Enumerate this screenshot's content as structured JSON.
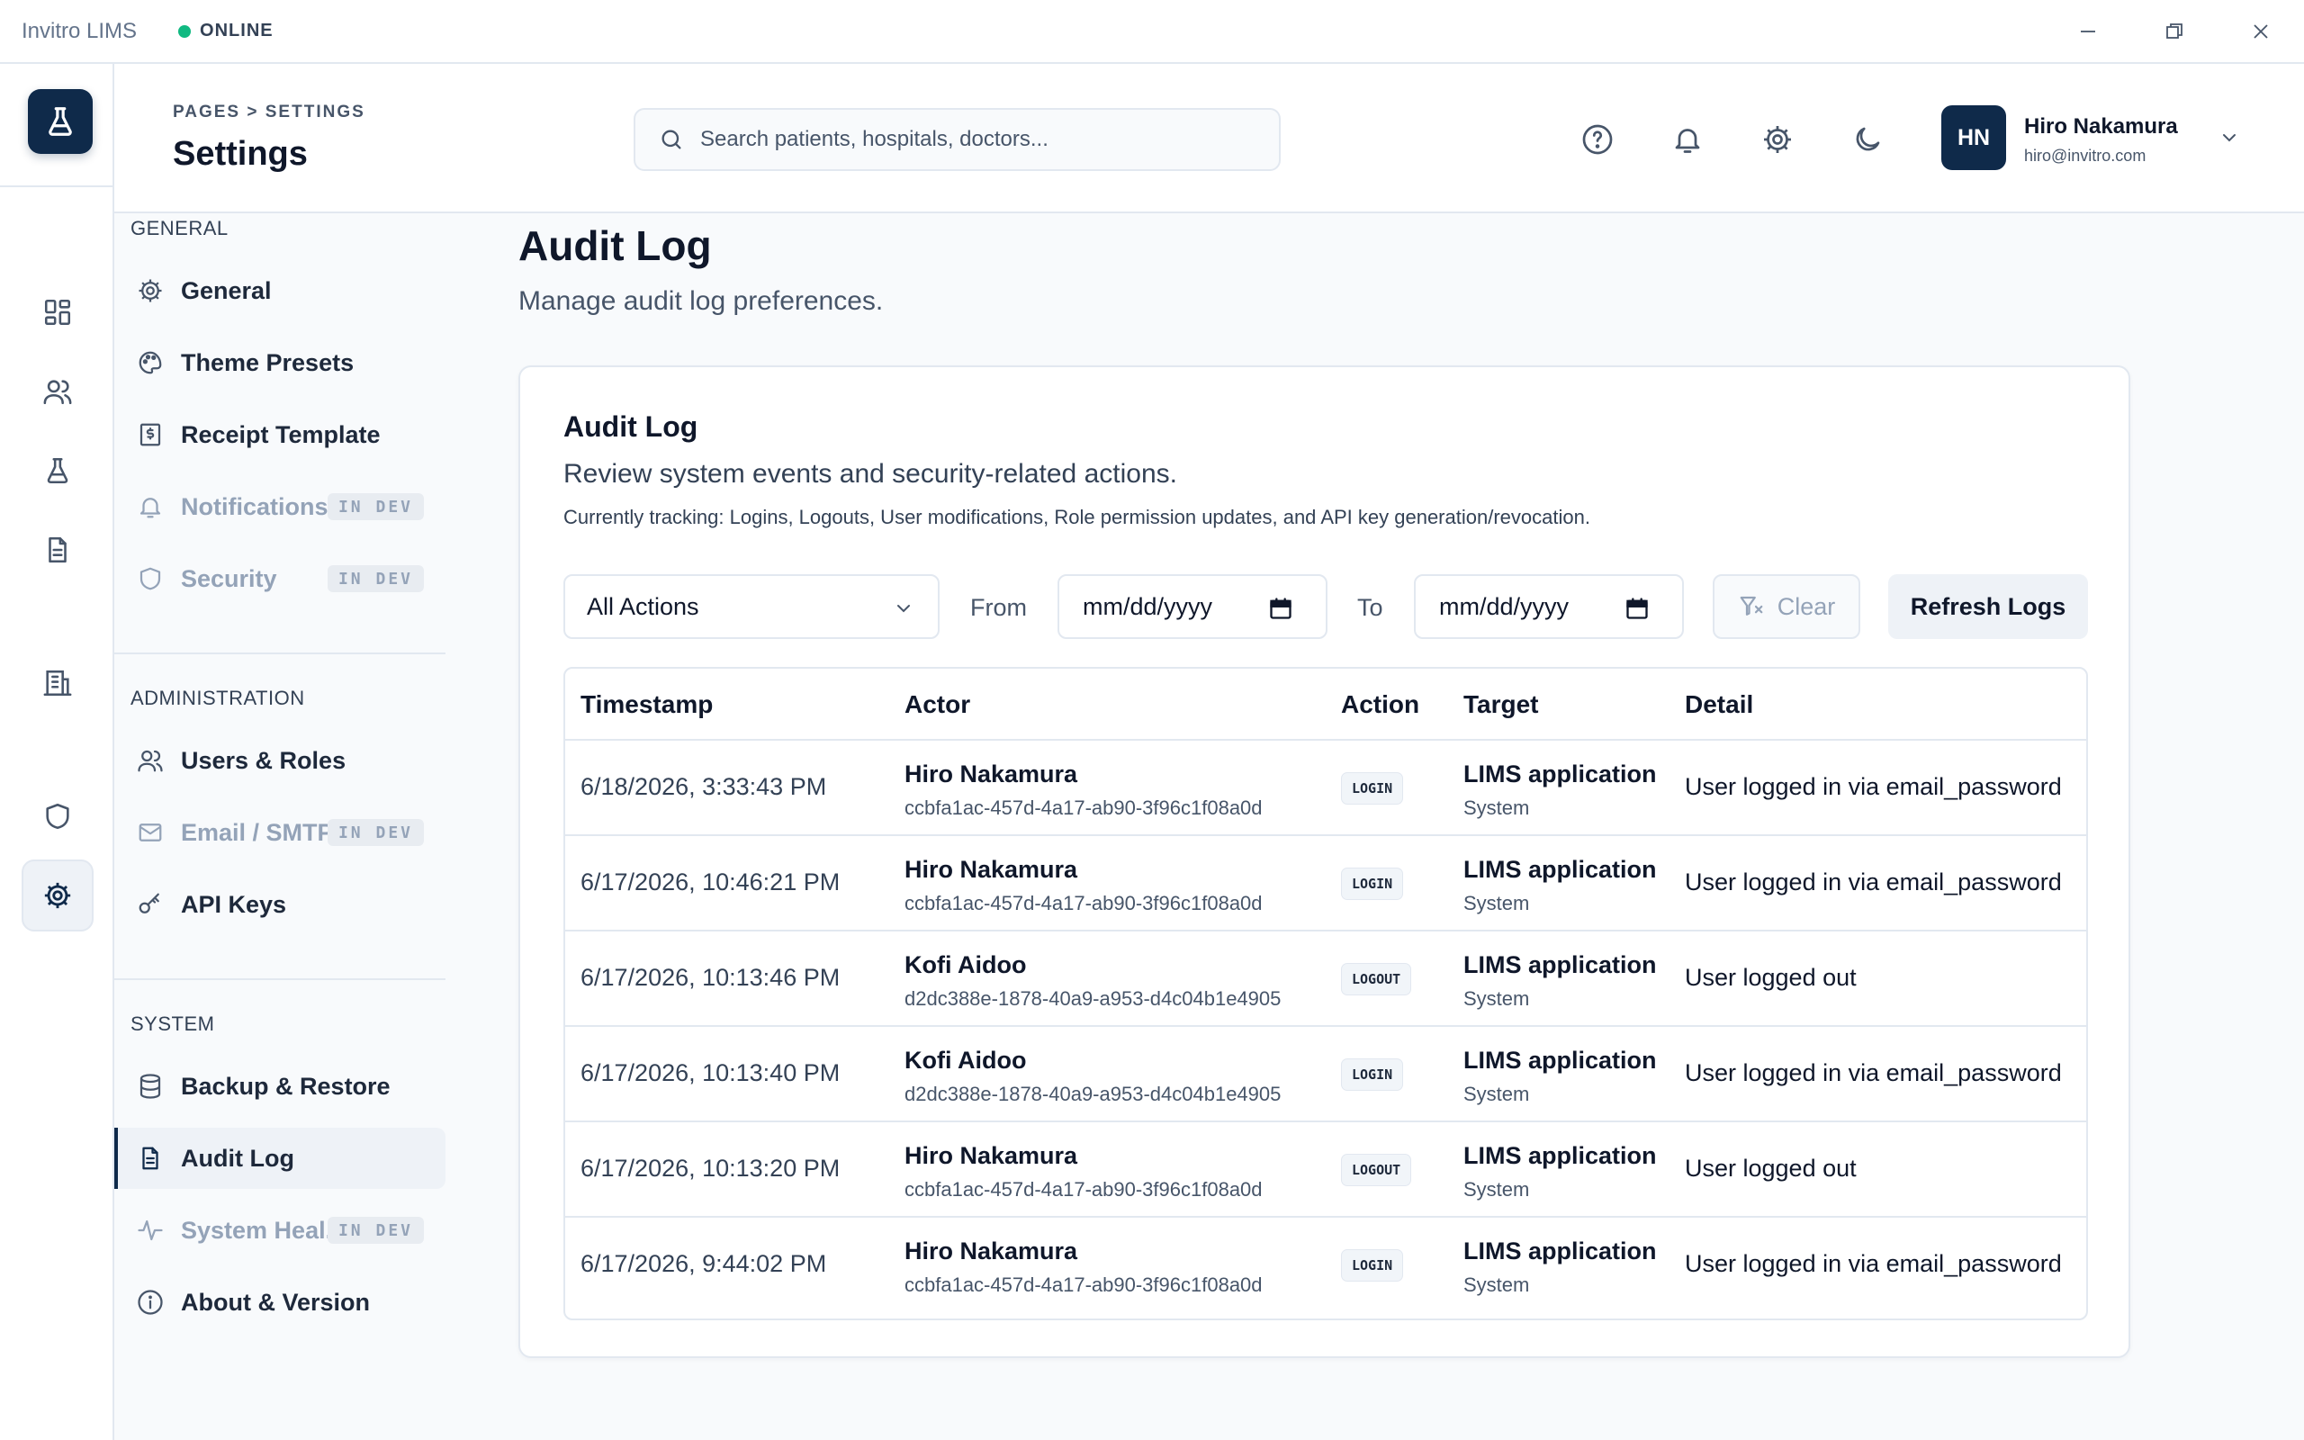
{
  "window": {
    "app_name": "Invitro LIMS",
    "status": "ONLINE"
  },
  "header": {
    "breadcrumb": "PAGES > SETTINGS",
    "title": "Settings",
    "search_placeholder": "Search patients, hospitals, doctors...",
    "user": {
      "initials": "HN",
      "name": "Hiro Nakamura",
      "email": "hiro@invitro.com"
    }
  },
  "settings_nav": {
    "sections": [
      {
        "label": "GENERAL",
        "items": [
          {
            "label": "General",
            "icon": "gear-icon"
          },
          {
            "label": "Theme Presets",
            "icon": "palette-icon"
          },
          {
            "label": "Receipt Template",
            "icon": "receipt-icon"
          },
          {
            "label": "Notifications",
            "icon": "bell-icon",
            "badge": "IN DEV"
          },
          {
            "label": "Security",
            "icon": "shield-icon",
            "badge": "IN DEV"
          }
        ]
      },
      {
        "label": "ADMINISTRATION",
        "items": [
          {
            "label": "Users & Roles",
            "icon": "users-icon"
          },
          {
            "label": "Email / SMTP",
            "icon": "mail-icon",
            "badge": "IN DEV"
          },
          {
            "label": "API Keys",
            "icon": "key-icon"
          }
        ]
      },
      {
        "label": "SYSTEM",
        "items": [
          {
            "label": "Backup & Restore",
            "icon": "database-icon"
          },
          {
            "label": "Audit Log",
            "icon": "document-icon",
            "active": true
          },
          {
            "label": "System Heal...",
            "icon": "activity-icon",
            "badge": "IN DEV"
          },
          {
            "label": "About & Version",
            "icon": "info-icon"
          }
        ]
      }
    ]
  },
  "main": {
    "title": "Audit Log",
    "subtitle": "Manage audit log preferences.",
    "card": {
      "title": "Audit Log",
      "subtitle": "Review system events and security-related actions.",
      "note": "Currently tracking: Logins, Logouts, User modifications, Role permission updates, and API key generation/revocation.",
      "filters": {
        "action_select": "All Actions",
        "from_label": "From",
        "from_value": "mm/dd/yyyy",
        "to_label": "To",
        "to_value": "mm/dd/yyyy",
        "clear_label": "Clear",
        "refresh_label": "Refresh Logs"
      },
      "table": {
        "columns": [
          "Timestamp",
          "Actor",
          "Action",
          "Target",
          "Detail"
        ],
        "rows": [
          {
            "timestamp": "6/18/2026, 3:33:43 PM",
            "actor": "Hiro Nakamura",
            "actor_id": "ccbfa1ac-457d-4a17-ab90-3f96c1f08a0d",
            "action": "LOGIN",
            "target": "LIMS application",
            "target_type": "System",
            "detail": "User logged in via email_password"
          },
          {
            "timestamp": "6/17/2026, 10:46:21 PM",
            "actor": "Hiro Nakamura",
            "actor_id": "ccbfa1ac-457d-4a17-ab90-3f96c1f08a0d",
            "action": "LOGIN",
            "target": "LIMS application",
            "target_type": "System",
            "detail": "User logged in via email_password"
          },
          {
            "timestamp": "6/17/2026, 10:13:46 PM",
            "actor": "Kofi Aidoo",
            "actor_id": "d2dc388e-1878-40a9-a953-d4c04b1e4905",
            "action": "LOGOUT",
            "target": "LIMS application",
            "target_type": "System",
            "detail": "User logged out"
          },
          {
            "timestamp": "6/17/2026, 10:13:40 PM",
            "actor": "Kofi Aidoo",
            "actor_id": "d2dc388e-1878-40a9-a953-d4c04b1e4905",
            "action": "LOGIN",
            "target": "LIMS application",
            "target_type": "System",
            "detail": "User logged in via email_password"
          },
          {
            "timestamp": "6/17/2026, 10:13:20 PM",
            "actor": "Hiro Nakamura",
            "actor_id": "ccbfa1ac-457d-4a17-ab90-3f96c1f08a0d",
            "action": "LOGOUT",
            "target": "LIMS application",
            "target_type": "System",
            "detail": "User logged out"
          },
          {
            "timestamp": "6/17/2026, 9:44:02 PM",
            "actor": "Hiro Nakamura",
            "actor_id": "ccbfa1ac-457d-4a17-ab90-3f96c1f08a0d",
            "action": "LOGIN",
            "target": "LIMS application",
            "target_type": "System",
            "detail": "User logged in via email_password"
          }
        ]
      }
    }
  },
  "colors": {
    "brand": "#0f2a4a",
    "online": "#10b981",
    "border": "#e2e8f0",
    "muted": "#94a3b8"
  }
}
